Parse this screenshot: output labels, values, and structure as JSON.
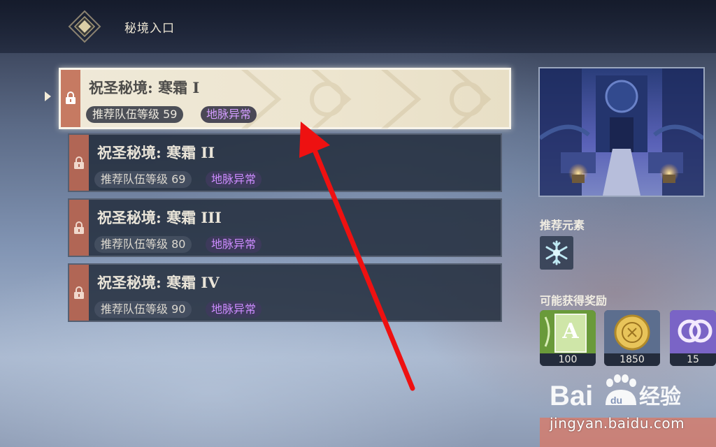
{
  "header": {
    "title": "秘境入口"
  },
  "domains": [
    {
      "name": "祝圣秘境: 寒霜 I",
      "level_label": "推荐队伍等级 59",
      "ley_label": "地脉异常",
      "locked": true,
      "selected": true
    },
    {
      "name": "祝圣秘境: 寒霜 II",
      "level_label": "推荐队伍等级 69",
      "ley_label": "地脉异常",
      "locked": true,
      "selected": false
    },
    {
      "name": "祝圣秘境: 寒霜 III",
      "level_label": "推荐队伍等级 80",
      "ley_label": "地脉异常",
      "locked": true,
      "selected": false
    },
    {
      "name": "祝圣秘境: 寒霜 IV",
      "level_label": "推荐队伍等级 90",
      "ley_label": "地脉异常",
      "locked": true,
      "selected": false
    }
  ],
  "sidebar": {
    "recommended_element_label": "推荐元素",
    "recommended_element_icon": "cryo-icon",
    "rewards_label": "可能获得奖励",
    "rewards": [
      {
        "icon": "ascension-material-icon",
        "count": "100"
      },
      {
        "icon": "mora-coin-icon",
        "count": "1850"
      },
      {
        "icon": "companionship-exp-icon",
        "count": "15"
      }
    ]
  },
  "watermark": {
    "brand": "Baidu经验",
    "url": "jingyan.baidu.com"
  },
  "colors": {
    "lock_strip": "#b16655",
    "ley_text": "#cd8cff",
    "annotation_arrow": "#ee1111"
  }
}
